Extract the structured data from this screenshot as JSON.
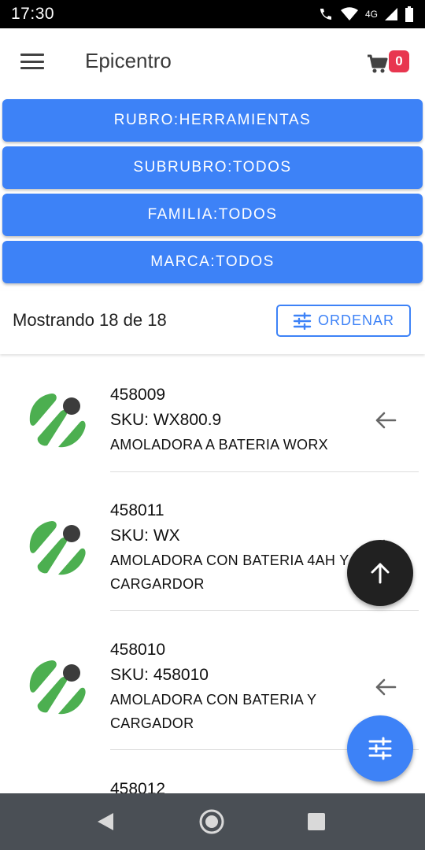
{
  "status": {
    "time": "17:30",
    "network": "4G"
  },
  "appbar": {
    "title": "Epicentro",
    "cart_count": "0"
  },
  "filters": [
    {
      "label": "RUBRO:HERRAMIENTAS"
    },
    {
      "label": "SUBRUBRO:TODOS"
    },
    {
      "label": "FAMILIA:TODOS"
    },
    {
      "label": "MARCA:TODOS"
    }
  ],
  "summary": {
    "text": "Mostrando 18 de 18",
    "sort_label": "ORDENAR"
  },
  "products": [
    {
      "code": "458009",
      "sku": "SKU: WX800.9",
      "desc": "AMOLADORA A BATERIA WORX"
    },
    {
      "code": "458011",
      "sku": "SKU: WX",
      "desc": "AMOLADORA CON BATERIA 4AH Y CARGARDOR"
    },
    {
      "code": "458010",
      "sku": "SKU: 458010",
      "desc": "AMOLADORA CON BATERIA Y CARGADOR"
    },
    {
      "code": "458012",
      "sku": "",
      "desc": ""
    }
  ],
  "colors": {
    "accent": "#3d82f7",
    "badge": "#e8364f",
    "logo_green": "#4caf50",
    "logo_dark": "#3c3c3c",
    "fab_dark": "#212121"
  },
  "icons": {
    "menu": "menu-icon",
    "cart": "cart-icon",
    "sort": "tune-icon",
    "item_action": "arrow-left-icon",
    "scroll_top": "arrow-up-icon",
    "filter_fab": "tune-icon"
  }
}
